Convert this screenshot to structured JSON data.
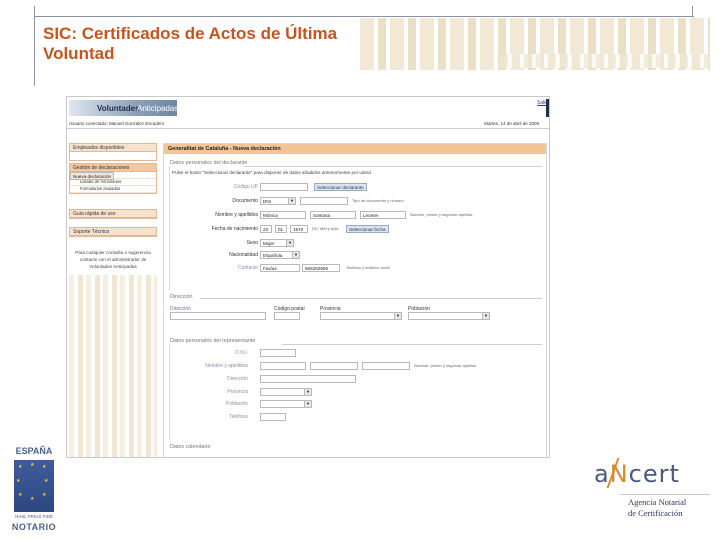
{
  "slide": {
    "title": "SIC: Certificados de Actos de Última Voluntad"
  },
  "app": {
    "brand_a": "Voluntades",
    "brand_b": "Anticipadas",
    "exit": "Salir",
    "user": "Usuario conectado: Manuel González Escudero",
    "date": "Martes, 14 de abril de 2009"
  },
  "sidebar": {
    "empleados": "Empleados disponibles",
    "gestion": "Gestión de declaraciones",
    "items": [
      "Nueva declaración",
      "Nueva revocación",
      "Listado de formularios",
      "Formularios anulados"
    ],
    "guia": "Guía rápida de uso",
    "soporte": "Soporte Técnico",
    "note": "Para cualquier consulta o sugerencia contacte con el administrador de Voluntades Anticipadas"
  },
  "form": {
    "header": "Generalitat de Cataluña - Nueva declaración",
    "section_declarante": "Datos personales del declarante",
    "info": "Pulse el botón \"Seleccionar declarante\" para disponer de datos añadidos anteriormente por usted.",
    "codigo_up_label": "Código UP",
    "btn_seleccionar_declarante": "Seleccionar declarante",
    "documento_label": "Documento",
    "documento_value": "DNI",
    "documento_hint": "Tipo de documento y número",
    "nombre_label": "Nombre y apellidos",
    "nombre_value": "Mónica",
    "apellido1_value": "Santana",
    "apellido2_value": "Leomer",
    "nombre_hint": "Nombre, primer y segundo apellido.",
    "fecha_label": "Fecha de nacimiento",
    "fecha_dd": "23",
    "fecha_mm": "01",
    "fecha_yyyy": "1970",
    "fecha_hint": "DD, MM y AAA",
    "btn_seleccionar_fecha": "Seleccionar fecha",
    "sexo_label": "Sexo",
    "sexo_value": "Mujer",
    "nacionalidad_label": "Nacionalidad",
    "nacionalidad_value": "Española",
    "contacto_label": "Contacto",
    "contacto_tipo": "Fax/ax",
    "contacto_value": "666262666",
    "contacto_hint": "Teléfono y teléfono móvil",
    "section_direccion": "Dirección",
    "dir_direccion": "Dirección",
    "dir_cp": "Código postal",
    "dir_provincia": "Provincia",
    "dir_poblacion": "Población",
    "section_representante": "Datos personales del representante",
    "rep_dni": "D.N.I.",
    "rep_nombre": "Nombre y apellidos",
    "rep_nombre_hint": "Nombre, primer y segundo apellido.",
    "rep_direccion": "Dirección",
    "rep_provincia": "Provincia",
    "rep_poblacion": "Población",
    "rep_telefono": "Teléfono",
    "section_calendario": "Datos calendario"
  },
  "logos": {
    "espana": "ESPAÑA",
    "motto": "NIHIL PRIUS FIDE",
    "notario": "NOTARIO",
    "ancert_a": "a",
    "ancert_n": "N",
    "ancert_rest": "cert",
    "ancert_line1": "Agencia Notarial",
    "ancert_line2": "de Certificación"
  },
  "colors": {
    "title": "#c8541b",
    "panel_header": "#f3c596",
    "sidebar_border": "#e1b996"
  }
}
